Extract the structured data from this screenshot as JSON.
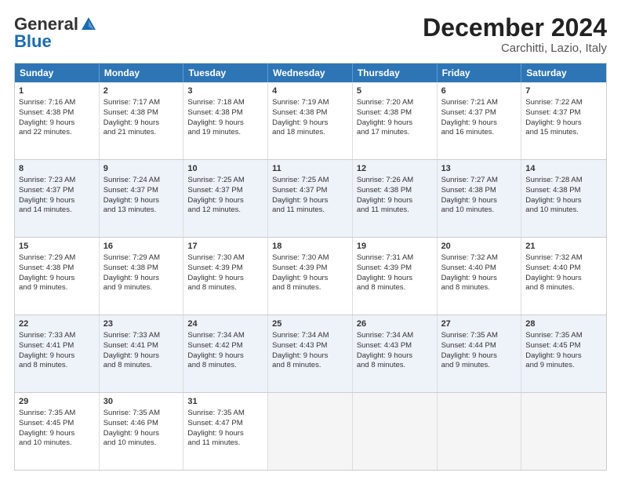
{
  "header": {
    "logo_general": "General",
    "logo_blue": "Blue",
    "month": "December 2024",
    "location": "Carchitti, Lazio, Italy"
  },
  "days": [
    "Sunday",
    "Monday",
    "Tuesday",
    "Wednesday",
    "Thursday",
    "Friday",
    "Saturday"
  ],
  "rows": [
    [
      {
        "day": "1",
        "lines": [
          "Sunrise: 7:16 AM",
          "Sunset: 4:38 PM",
          "Daylight: 9 hours",
          "and 22 minutes."
        ]
      },
      {
        "day": "2",
        "lines": [
          "Sunrise: 7:17 AM",
          "Sunset: 4:38 PM",
          "Daylight: 9 hours",
          "and 21 minutes."
        ]
      },
      {
        "day": "3",
        "lines": [
          "Sunrise: 7:18 AM",
          "Sunset: 4:38 PM",
          "Daylight: 9 hours",
          "and 19 minutes."
        ]
      },
      {
        "day": "4",
        "lines": [
          "Sunrise: 7:19 AM",
          "Sunset: 4:38 PM",
          "Daylight: 9 hours",
          "and 18 minutes."
        ]
      },
      {
        "day": "5",
        "lines": [
          "Sunrise: 7:20 AM",
          "Sunset: 4:38 PM",
          "Daylight: 9 hours",
          "and 17 minutes."
        ]
      },
      {
        "day": "6",
        "lines": [
          "Sunrise: 7:21 AM",
          "Sunset: 4:37 PM",
          "Daylight: 9 hours",
          "and 16 minutes."
        ]
      },
      {
        "day": "7",
        "lines": [
          "Sunrise: 7:22 AM",
          "Sunset: 4:37 PM",
          "Daylight: 9 hours",
          "and 15 minutes."
        ]
      }
    ],
    [
      {
        "day": "8",
        "lines": [
          "Sunrise: 7:23 AM",
          "Sunset: 4:37 PM",
          "Daylight: 9 hours",
          "and 14 minutes."
        ]
      },
      {
        "day": "9",
        "lines": [
          "Sunrise: 7:24 AM",
          "Sunset: 4:37 PM",
          "Daylight: 9 hours",
          "and 13 minutes."
        ]
      },
      {
        "day": "10",
        "lines": [
          "Sunrise: 7:25 AM",
          "Sunset: 4:37 PM",
          "Daylight: 9 hours",
          "and 12 minutes."
        ]
      },
      {
        "day": "11",
        "lines": [
          "Sunrise: 7:25 AM",
          "Sunset: 4:37 PM",
          "Daylight: 9 hours",
          "and 11 minutes."
        ]
      },
      {
        "day": "12",
        "lines": [
          "Sunrise: 7:26 AM",
          "Sunset: 4:38 PM",
          "Daylight: 9 hours",
          "and 11 minutes."
        ]
      },
      {
        "day": "13",
        "lines": [
          "Sunrise: 7:27 AM",
          "Sunset: 4:38 PM",
          "Daylight: 9 hours",
          "and 10 minutes."
        ]
      },
      {
        "day": "14",
        "lines": [
          "Sunrise: 7:28 AM",
          "Sunset: 4:38 PM",
          "Daylight: 9 hours",
          "and 10 minutes."
        ]
      }
    ],
    [
      {
        "day": "15",
        "lines": [
          "Sunrise: 7:29 AM",
          "Sunset: 4:38 PM",
          "Daylight: 9 hours",
          "and 9 minutes."
        ]
      },
      {
        "day": "16",
        "lines": [
          "Sunrise: 7:29 AM",
          "Sunset: 4:38 PM",
          "Daylight: 9 hours",
          "and 9 minutes."
        ]
      },
      {
        "day": "17",
        "lines": [
          "Sunrise: 7:30 AM",
          "Sunset: 4:39 PM",
          "Daylight: 9 hours",
          "and 8 minutes."
        ]
      },
      {
        "day": "18",
        "lines": [
          "Sunrise: 7:30 AM",
          "Sunset: 4:39 PM",
          "Daylight: 9 hours",
          "and 8 minutes."
        ]
      },
      {
        "day": "19",
        "lines": [
          "Sunrise: 7:31 AM",
          "Sunset: 4:39 PM",
          "Daylight: 9 hours",
          "and 8 minutes."
        ]
      },
      {
        "day": "20",
        "lines": [
          "Sunrise: 7:32 AM",
          "Sunset: 4:40 PM",
          "Daylight: 9 hours",
          "and 8 minutes."
        ]
      },
      {
        "day": "21",
        "lines": [
          "Sunrise: 7:32 AM",
          "Sunset: 4:40 PM",
          "Daylight: 9 hours",
          "and 8 minutes."
        ]
      }
    ],
    [
      {
        "day": "22",
        "lines": [
          "Sunrise: 7:33 AM",
          "Sunset: 4:41 PM",
          "Daylight: 9 hours",
          "and 8 minutes."
        ]
      },
      {
        "day": "23",
        "lines": [
          "Sunrise: 7:33 AM",
          "Sunset: 4:41 PM",
          "Daylight: 9 hours",
          "and 8 minutes."
        ]
      },
      {
        "day": "24",
        "lines": [
          "Sunrise: 7:34 AM",
          "Sunset: 4:42 PM",
          "Daylight: 9 hours",
          "and 8 minutes."
        ]
      },
      {
        "day": "25",
        "lines": [
          "Sunrise: 7:34 AM",
          "Sunset: 4:43 PM",
          "Daylight: 9 hours",
          "and 8 minutes."
        ]
      },
      {
        "day": "26",
        "lines": [
          "Sunrise: 7:34 AM",
          "Sunset: 4:43 PM",
          "Daylight: 9 hours",
          "and 8 minutes."
        ]
      },
      {
        "day": "27",
        "lines": [
          "Sunrise: 7:35 AM",
          "Sunset: 4:44 PM",
          "Daylight: 9 hours",
          "and 9 minutes."
        ]
      },
      {
        "day": "28",
        "lines": [
          "Sunrise: 7:35 AM",
          "Sunset: 4:45 PM",
          "Daylight: 9 hours",
          "and 9 minutes."
        ]
      }
    ],
    [
      {
        "day": "29",
        "lines": [
          "Sunrise: 7:35 AM",
          "Sunset: 4:45 PM",
          "Daylight: 9 hours",
          "and 10 minutes."
        ]
      },
      {
        "day": "30",
        "lines": [
          "Sunrise: 7:35 AM",
          "Sunset: 4:46 PM",
          "Daylight: 9 hours",
          "and 10 minutes."
        ]
      },
      {
        "day": "31",
        "lines": [
          "Sunrise: 7:35 AM",
          "Sunset: 4:47 PM",
          "Daylight: 9 hours",
          "and 11 minutes."
        ]
      },
      {
        "day": "",
        "lines": []
      },
      {
        "day": "",
        "lines": []
      },
      {
        "day": "",
        "lines": []
      },
      {
        "day": "",
        "lines": []
      }
    ]
  ]
}
